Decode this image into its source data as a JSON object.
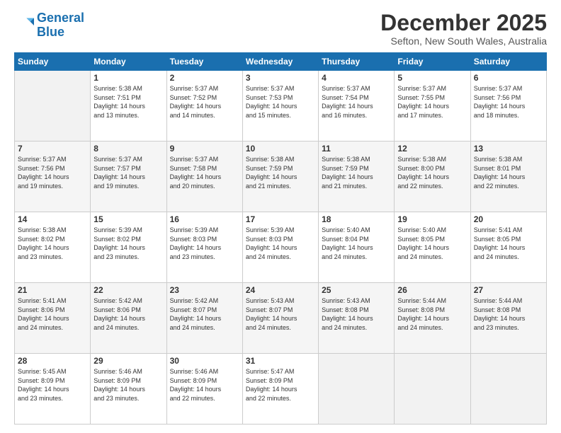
{
  "logo": {
    "text1": "General",
    "text2": "Blue"
  },
  "header": {
    "month": "December 2025",
    "location": "Sefton, New South Wales, Australia"
  },
  "weekdays": [
    "Sunday",
    "Monday",
    "Tuesday",
    "Wednesday",
    "Thursday",
    "Friday",
    "Saturday"
  ],
  "weeks": [
    [
      {
        "day": "",
        "info": ""
      },
      {
        "day": "1",
        "info": "Sunrise: 5:38 AM\nSunset: 7:51 PM\nDaylight: 14 hours\nand 13 minutes."
      },
      {
        "day": "2",
        "info": "Sunrise: 5:37 AM\nSunset: 7:52 PM\nDaylight: 14 hours\nand 14 minutes."
      },
      {
        "day": "3",
        "info": "Sunrise: 5:37 AM\nSunset: 7:53 PM\nDaylight: 14 hours\nand 15 minutes."
      },
      {
        "day": "4",
        "info": "Sunrise: 5:37 AM\nSunset: 7:54 PM\nDaylight: 14 hours\nand 16 minutes."
      },
      {
        "day": "5",
        "info": "Sunrise: 5:37 AM\nSunset: 7:55 PM\nDaylight: 14 hours\nand 17 minutes."
      },
      {
        "day": "6",
        "info": "Sunrise: 5:37 AM\nSunset: 7:56 PM\nDaylight: 14 hours\nand 18 minutes."
      }
    ],
    [
      {
        "day": "7",
        "info": "Sunrise: 5:37 AM\nSunset: 7:56 PM\nDaylight: 14 hours\nand 19 minutes."
      },
      {
        "day": "8",
        "info": "Sunrise: 5:37 AM\nSunset: 7:57 PM\nDaylight: 14 hours\nand 19 minutes."
      },
      {
        "day": "9",
        "info": "Sunrise: 5:37 AM\nSunset: 7:58 PM\nDaylight: 14 hours\nand 20 minutes."
      },
      {
        "day": "10",
        "info": "Sunrise: 5:38 AM\nSunset: 7:59 PM\nDaylight: 14 hours\nand 21 minutes."
      },
      {
        "day": "11",
        "info": "Sunrise: 5:38 AM\nSunset: 7:59 PM\nDaylight: 14 hours\nand 21 minutes."
      },
      {
        "day": "12",
        "info": "Sunrise: 5:38 AM\nSunset: 8:00 PM\nDaylight: 14 hours\nand 22 minutes."
      },
      {
        "day": "13",
        "info": "Sunrise: 5:38 AM\nSunset: 8:01 PM\nDaylight: 14 hours\nand 22 minutes."
      }
    ],
    [
      {
        "day": "14",
        "info": "Sunrise: 5:38 AM\nSunset: 8:02 PM\nDaylight: 14 hours\nand 23 minutes."
      },
      {
        "day": "15",
        "info": "Sunrise: 5:39 AM\nSunset: 8:02 PM\nDaylight: 14 hours\nand 23 minutes."
      },
      {
        "day": "16",
        "info": "Sunrise: 5:39 AM\nSunset: 8:03 PM\nDaylight: 14 hours\nand 23 minutes."
      },
      {
        "day": "17",
        "info": "Sunrise: 5:39 AM\nSunset: 8:03 PM\nDaylight: 14 hours\nand 24 minutes."
      },
      {
        "day": "18",
        "info": "Sunrise: 5:40 AM\nSunset: 8:04 PM\nDaylight: 14 hours\nand 24 minutes."
      },
      {
        "day": "19",
        "info": "Sunrise: 5:40 AM\nSunset: 8:05 PM\nDaylight: 14 hours\nand 24 minutes."
      },
      {
        "day": "20",
        "info": "Sunrise: 5:41 AM\nSunset: 8:05 PM\nDaylight: 14 hours\nand 24 minutes."
      }
    ],
    [
      {
        "day": "21",
        "info": "Sunrise: 5:41 AM\nSunset: 8:06 PM\nDaylight: 14 hours\nand 24 minutes."
      },
      {
        "day": "22",
        "info": "Sunrise: 5:42 AM\nSunset: 8:06 PM\nDaylight: 14 hours\nand 24 minutes."
      },
      {
        "day": "23",
        "info": "Sunrise: 5:42 AM\nSunset: 8:07 PM\nDaylight: 14 hours\nand 24 minutes."
      },
      {
        "day": "24",
        "info": "Sunrise: 5:43 AM\nSunset: 8:07 PM\nDaylight: 14 hours\nand 24 minutes."
      },
      {
        "day": "25",
        "info": "Sunrise: 5:43 AM\nSunset: 8:08 PM\nDaylight: 14 hours\nand 24 minutes."
      },
      {
        "day": "26",
        "info": "Sunrise: 5:44 AM\nSunset: 8:08 PM\nDaylight: 14 hours\nand 24 minutes."
      },
      {
        "day": "27",
        "info": "Sunrise: 5:44 AM\nSunset: 8:08 PM\nDaylight: 14 hours\nand 23 minutes."
      }
    ],
    [
      {
        "day": "28",
        "info": "Sunrise: 5:45 AM\nSunset: 8:09 PM\nDaylight: 14 hours\nand 23 minutes."
      },
      {
        "day": "29",
        "info": "Sunrise: 5:46 AM\nSunset: 8:09 PM\nDaylight: 14 hours\nand 23 minutes."
      },
      {
        "day": "30",
        "info": "Sunrise: 5:46 AM\nSunset: 8:09 PM\nDaylight: 14 hours\nand 22 minutes."
      },
      {
        "day": "31",
        "info": "Sunrise: 5:47 AM\nSunset: 8:09 PM\nDaylight: 14 hours\nand 22 minutes."
      },
      {
        "day": "",
        "info": ""
      },
      {
        "day": "",
        "info": ""
      },
      {
        "day": "",
        "info": ""
      }
    ]
  ]
}
